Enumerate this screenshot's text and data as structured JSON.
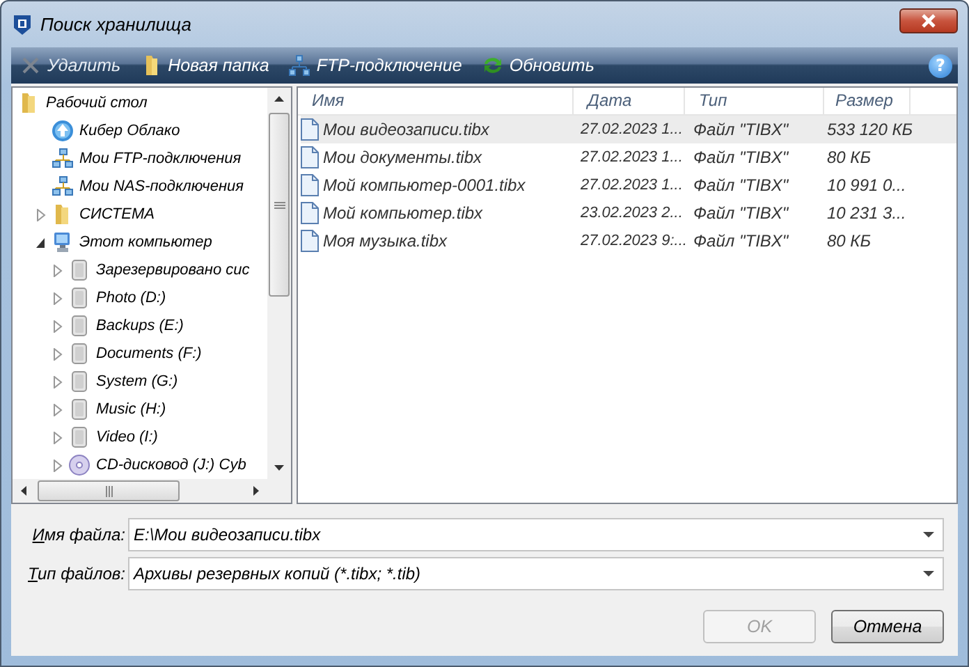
{
  "window": {
    "title": "Поиск хранилища"
  },
  "toolbar": {
    "items": [
      {
        "kind": "delete",
        "label": "Удалить",
        "disabled": true
      },
      {
        "kind": "new-folder",
        "label": "Новая папка",
        "disabled": false
      },
      {
        "kind": "ftp",
        "label": "FTP-подключение",
        "disabled": false
      },
      {
        "kind": "refresh",
        "label": "Обновить",
        "disabled": false
      }
    ],
    "help": "?"
  },
  "tree": {
    "items": [
      {
        "kind": "folder",
        "label": "Рабочий стол",
        "children": [
          {
            "kind": "cloud",
            "label": "Кибер Облако"
          },
          {
            "kind": "network",
            "label": "Мои FTP-подключения"
          },
          {
            "kind": "network",
            "label": "Мои NAS-подключения"
          },
          {
            "kind": "folder",
            "label": "СИСТЕМА",
            "expanded": false
          },
          {
            "kind": "computer",
            "label": "Этот компьютер",
            "expanded": true,
            "children": [
              {
                "kind": "drive",
                "label": "Зарезервировано сис",
                "expanded": false
              },
              {
                "kind": "drive",
                "label": "Photo (D:)",
                "expanded": false
              },
              {
                "kind": "drive",
                "label": "Backups (E:)",
                "expanded": false
              },
              {
                "kind": "drive",
                "label": "Documents (F:)",
                "expanded": false
              },
              {
                "kind": "drive",
                "label": "System (G:)",
                "expanded": false
              },
              {
                "kind": "drive",
                "label": "Music (H:)",
                "expanded": false
              },
              {
                "kind": "drive",
                "label": "Video (I:)",
                "expanded": false
              },
              {
                "kind": "cd",
                "label": "CD-дисковод (J:) Cyb",
                "expanded": false
              }
            ]
          }
        ]
      }
    ]
  },
  "file_list": {
    "columns": [
      "Имя",
      "Дата",
      "Тип",
      "Размер"
    ],
    "rows": [
      {
        "name": "Мои видеозаписи.tibx",
        "date": "27.02.2023 1...",
        "type": "Файл \"TIBX\"",
        "size": "533 120 КБ",
        "selected": true
      },
      {
        "name": "Мои документы.tibx",
        "date": "27.02.2023 1...",
        "type": "Файл \"TIBX\"",
        "size": "80 КБ",
        "selected": false
      },
      {
        "name": "Мой компьютер-0001.tibx",
        "date": "27.02.2023 1...",
        "type": "Файл \"TIBX\"",
        "size": "10 991 0...",
        "selected": false
      },
      {
        "name": "Мой компьютер.tibx",
        "date": "23.02.2023 2...",
        "type": "Файл \"TIBX\"",
        "size": "10 231 3...",
        "selected": false
      },
      {
        "name": "Моя музыка.tibx",
        "date": "27.02.2023 9:...",
        "type": "Файл \"TIBX\"",
        "size": "80 КБ",
        "selected": false
      }
    ]
  },
  "fields": [
    {
      "label": "Имя файла:",
      "value": "E:\\Мои видеозаписи.tibx"
    },
    {
      "label": "Тип файлов:",
      "value": "Архивы резервных копий (*.tibx; *.tib)"
    }
  ],
  "buttons": [
    {
      "label": "OK",
      "disabled": true
    },
    {
      "label": "Отмена",
      "disabled": false
    }
  ]
}
